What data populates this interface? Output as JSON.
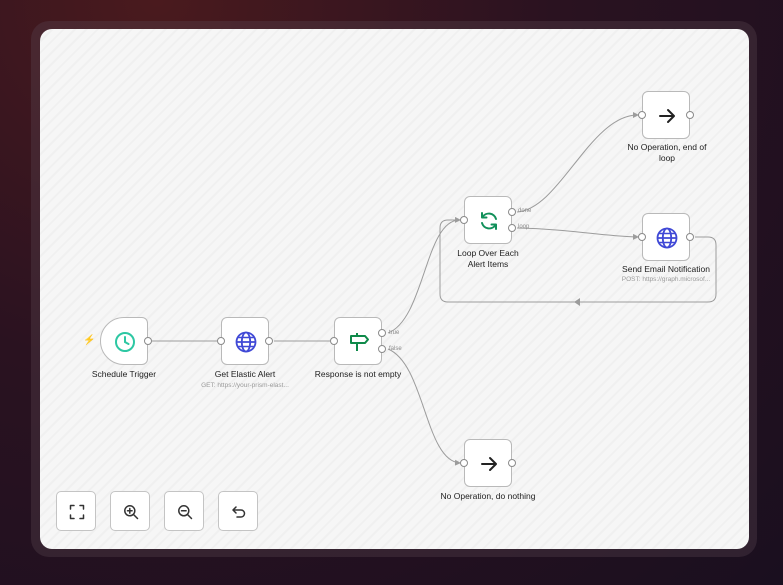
{
  "nodes": {
    "schedule_trigger": {
      "label": "Schedule Trigger",
      "icon": "clock-icon"
    },
    "get_elastic_alert": {
      "label": "Get Elastic Alert",
      "subtitle": "GET: https://your-prism-elast...",
      "icon": "globe-icon"
    },
    "response_check": {
      "label": "Response is not empty",
      "icon": "signpost-icon",
      "ports": {
        "true": "true",
        "false": "false"
      }
    },
    "loop_over_items": {
      "label": "Loop Over Each Alert Items",
      "icon": "loop-icon",
      "ports": {
        "done": "done",
        "loop": "loop"
      }
    },
    "no_op_end_of_loop": {
      "label": "No Operation, end of loop",
      "icon": "arrow-right-icon"
    },
    "send_email": {
      "label": "Send Email Notification",
      "subtitle": "POST: https://graph.microsof...",
      "icon": "globe-icon"
    },
    "no_op_nothing": {
      "label": "No Operation, do nothing",
      "icon": "arrow-right-icon"
    }
  },
  "controls": [
    {
      "name": "fit-view-button",
      "icon": "expand-icon"
    },
    {
      "name": "zoom-in-button",
      "icon": "zoom-in-icon"
    },
    {
      "name": "zoom-out-button",
      "icon": "zoom-out-icon"
    },
    {
      "name": "reset-zoom-button",
      "icon": "undo-icon"
    }
  ],
  "colors": {
    "trigger_icon": "#2dc7a3",
    "http_icon": "#4049d6",
    "if_icon": "#0f8a4a",
    "loop_icon": "#11905a",
    "noop_icon": "#222222",
    "bolt": "#ff6d5a",
    "edge": "#9c9c9c"
  }
}
